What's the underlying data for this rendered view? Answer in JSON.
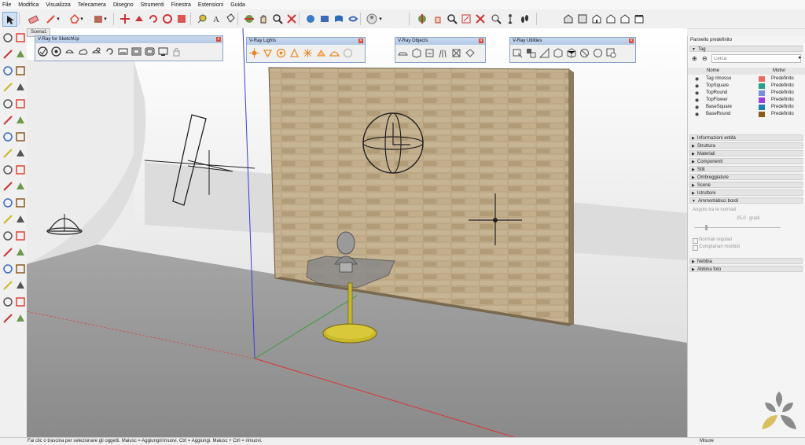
{
  "menu": [
    "File",
    "Modifica",
    "Visualizza",
    "Telecamera",
    "Disegno",
    "Strumenti",
    "Finestra",
    "Estensioni",
    "Guida"
  ],
  "scene_tab": "Scena1",
  "vray": {
    "sketchup": {
      "title": "V-Ray for SketchUp"
    },
    "lights": {
      "title": "V-Ray Lights"
    },
    "objects": {
      "title": "V-Ray Objects"
    },
    "utilities": {
      "title": "V-Ray Utilities"
    }
  },
  "panel": {
    "title": "Pannello predefinito",
    "tag_section": "Tag",
    "search_placeholder": "Cerca",
    "col_name": "Nome",
    "col_pattern": "Motivi",
    "tags": [
      {
        "name": "Tag rimosso",
        "color": "#e86a6a",
        "dash": "Predefinito"
      },
      {
        "name": "TopSquare",
        "color": "#2aa08a",
        "dash": "Predefinito"
      },
      {
        "name": "TopRound",
        "color": "#7b8fd8",
        "dash": "Predefinito"
      },
      {
        "name": "TopFlower",
        "color": "#9b3fd8",
        "dash": "Predefinito"
      },
      {
        "name": "BaseSquare",
        "color": "#1f7fa8",
        "dash": "Predefinito"
      },
      {
        "name": "BaseRound",
        "color": "#8a5a22",
        "dash": "Predefinito"
      }
    ],
    "sections": [
      "Informazioni entità",
      "Struttura",
      "Materiali",
      "Componenti",
      "Stili",
      "Ombreggiature",
      "Scene",
      "Istruttore",
      "Ammorbidisci bordi"
    ],
    "smooth": {
      "angle_label": "Angolo tra le normali",
      "angle_value": "25,0",
      "angle_unit": "gradi",
      "normal_label": "Normali regolari",
      "coplanar_label": "Complanari morbidi"
    },
    "bottom_sections": [
      "Nebbia",
      "Abbina foto"
    ]
  },
  "status": {
    "text": "Fai clic o trascina per selezionare gli oggetti. Maiusc = Aggiungi/rimuovi. Ctrl = Aggiungi. Maiusc + Ctrl = rimuovi.",
    "right": "Misure"
  },
  "colors": {
    "accent_blue": "#3f6fb8",
    "wall": "#b8a484",
    "table_base": "#c9b82a"
  }
}
